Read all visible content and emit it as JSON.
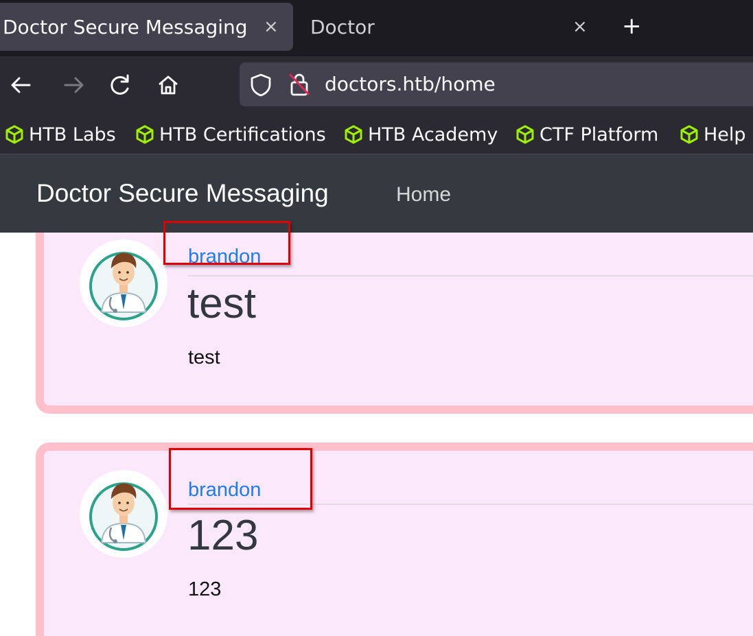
{
  "browser": {
    "tabs": [
      {
        "title": "Doctor Secure Messaging",
        "close": "×",
        "active": true
      },
      {
        "title": "Doctor",
        "close": "×",
        "active": false
      }
    ],
    "new_tab": "+",
    "url": "doctors.htb/home",
    "bookmarks": [
      {
        "label": "HTB Labs",
        "icon": "cube-icon"
      },
      {
        "label": "HTB Certifications",
        "icon": "cube-icon"
      },
      {
        "label": "HTB Academy",
        "icon": "cube-icon"
      },
      {
        "label": "CTF Platform",
        "icon": "cube-icon"
      },
      {
        "label": "Help",
        "icon": "cube-icon"
      }
    ],
    "accent_color": "#9fef00"
  },
  "site": {
    "brand": "Doctor Secure Messaging",
    "nav": [
      {
        "label": "Home"
      }
    ]
  },
  "posts": [
    {
      "author": "brandon",
      "title": "test",
      "body": "test"
    },
    {
      "author": "brandon",
      "title": "123",
      "body": "123"
    }
  ],
  "colors": {
    "post_background": "#fce8fb",
    "post_border": "#ffc0cb",
    "author_link": "#1c7cf0",
    "highlight_box": "#e00000"
  }
}
